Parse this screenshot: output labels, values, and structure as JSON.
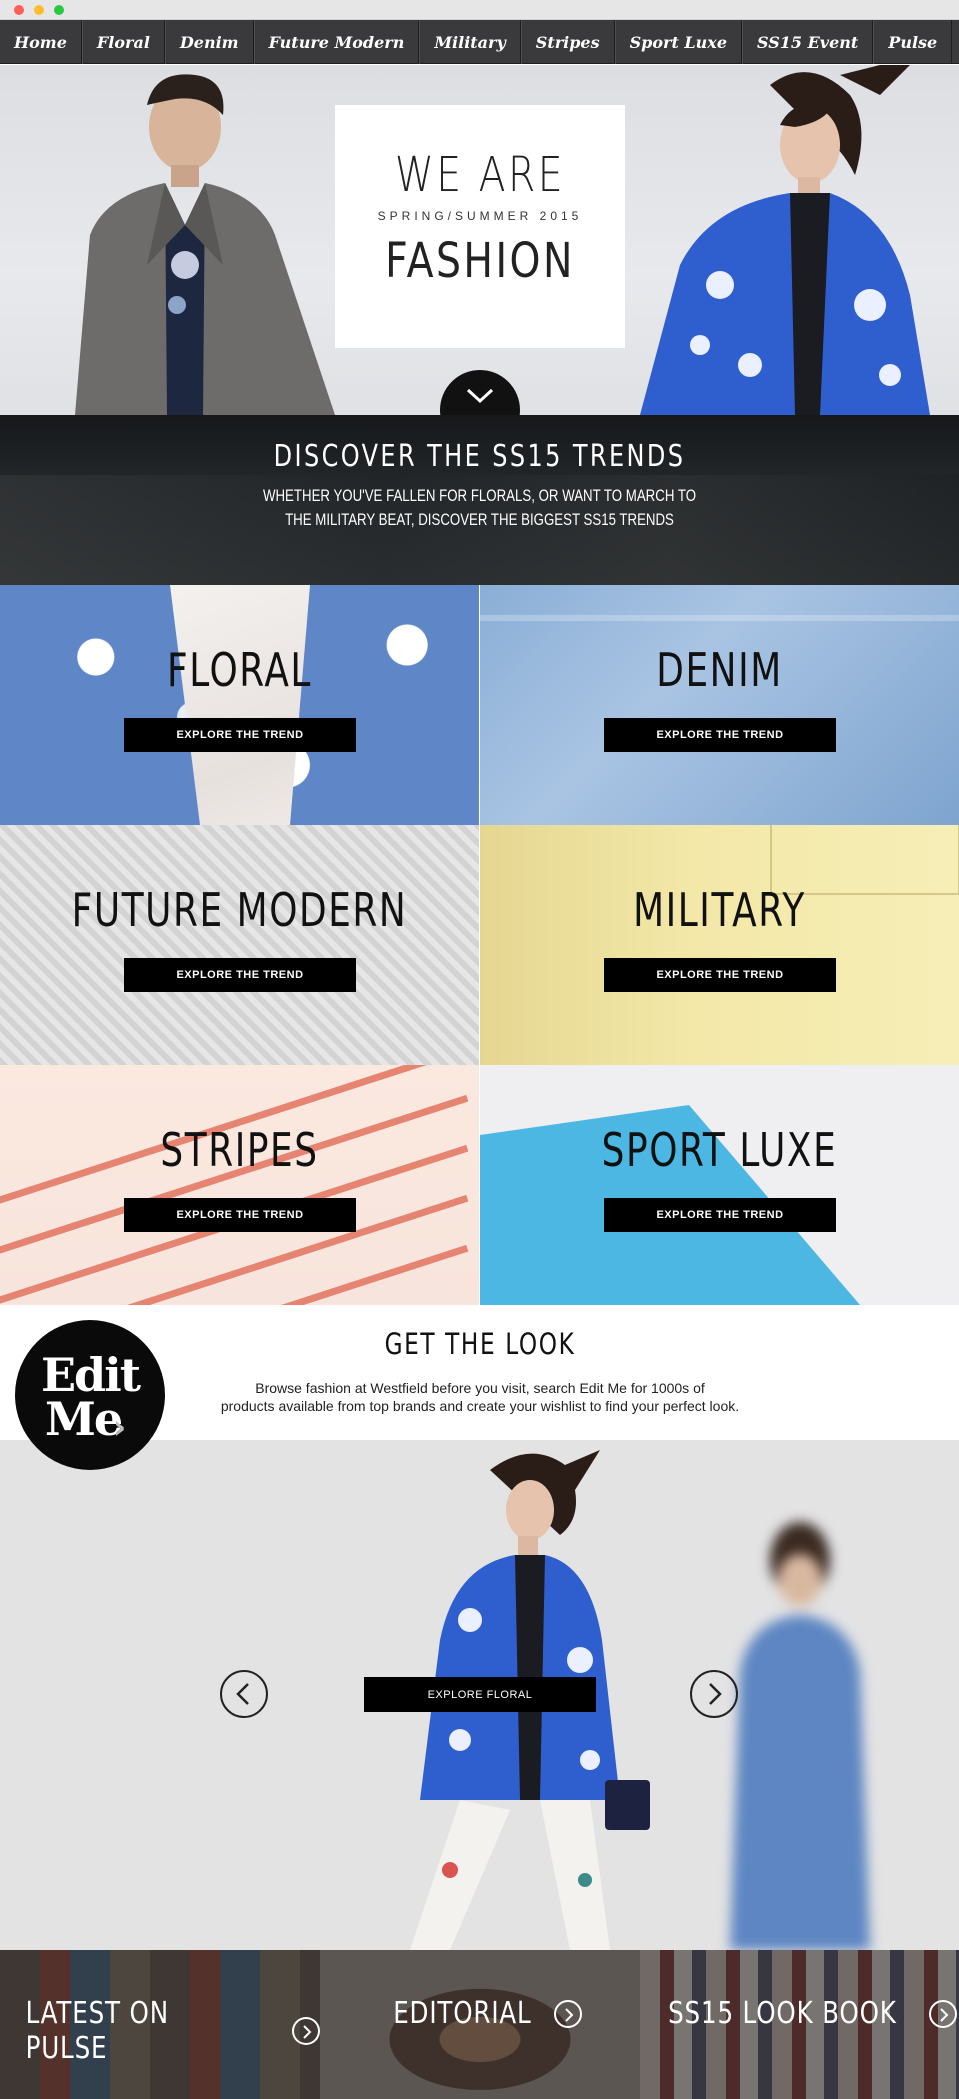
{
  "nav": {
    "items": [
      {
        "label": "Home"
      },
      {
        "label": "Floral"
      },
      {
        "label": "Denim"
      },
      {
        "label": "Future Modern"
      },
      {
        "label": "Military"
      },
      {
        "label": "Stripes"
      },
      {
        "label": "Sport Luxe"
      },
      {
        "label": "SS15 Event"
      },
      {
        "label": "Pulse"
      }
    ]
  },
  "hero": {
    "line1": "WE ARE",
    "line2": "SPRING/SUMMER 2015",
    "line3": "FASHION",
    "scroll_icon": "chevron-down-icon"
  },
  "discover": {
    "title": "DISCOVER THE SS15 TRENDS",
    "text_line1": "WHETHER YOU'VE FALLEN FOR FLORALS, OR WANT TO MARCH TO",
    "text_line2": "THE MILITARY BEAT, DISCOVER THE BIGGEST SS15 TRENDS"
  },
  "trends": [
    {
      "title": "FLORAL",
      "button": "EXPLORE THE TREND"
    },
    {
      "title": "DENIM",
      "button": "EXPLORE THE TREND"
    },
    {
      "title": "FUTURE MODERN",
      "button": "EXPLORE THE TREND"
    },
    {
      "title": "MILITARY",
      "button": "EXPLORE THE TREND"
    },
    {
      "title": "STRIPES",
      "button": "EXPLORE THE TREND"
    },
    {
      "title": "SPORT LUXE",
      "button": "EXPLORE THE TREND"
    }
  ],
  "getlook": {
    "logo_line1": "Edit",
    "logo_line2": "Me",
    "title": "GET THE LOOK",
    "text_line1": "Browse fashion at Westfield before you visit, search Edit Me for 1000s of",
    "text_line2": "products available from top brands and create your wishlist to find your perfect look."
  },
  "carousel": {
    "button": "EXPLORE FLORAL",
    "prev_icon": "chevron-left-icon",
    "next_icon": "chevron-right-icon"
  },
  "promos": [
    {
      "label": "LATEST ON PULSE"
    },
    {
      "label": "EDITORIAL"
    },
    {
      "label": "SS15 LOOK BOOK"
    }
  ],
  "colors": {
    "nav_bg": "#3a3a3c",
    "button_bg": "#000000",
    "sport_blue": "#4cb7e3",
    "floral_blue": "#5f86c6"
  }
}
